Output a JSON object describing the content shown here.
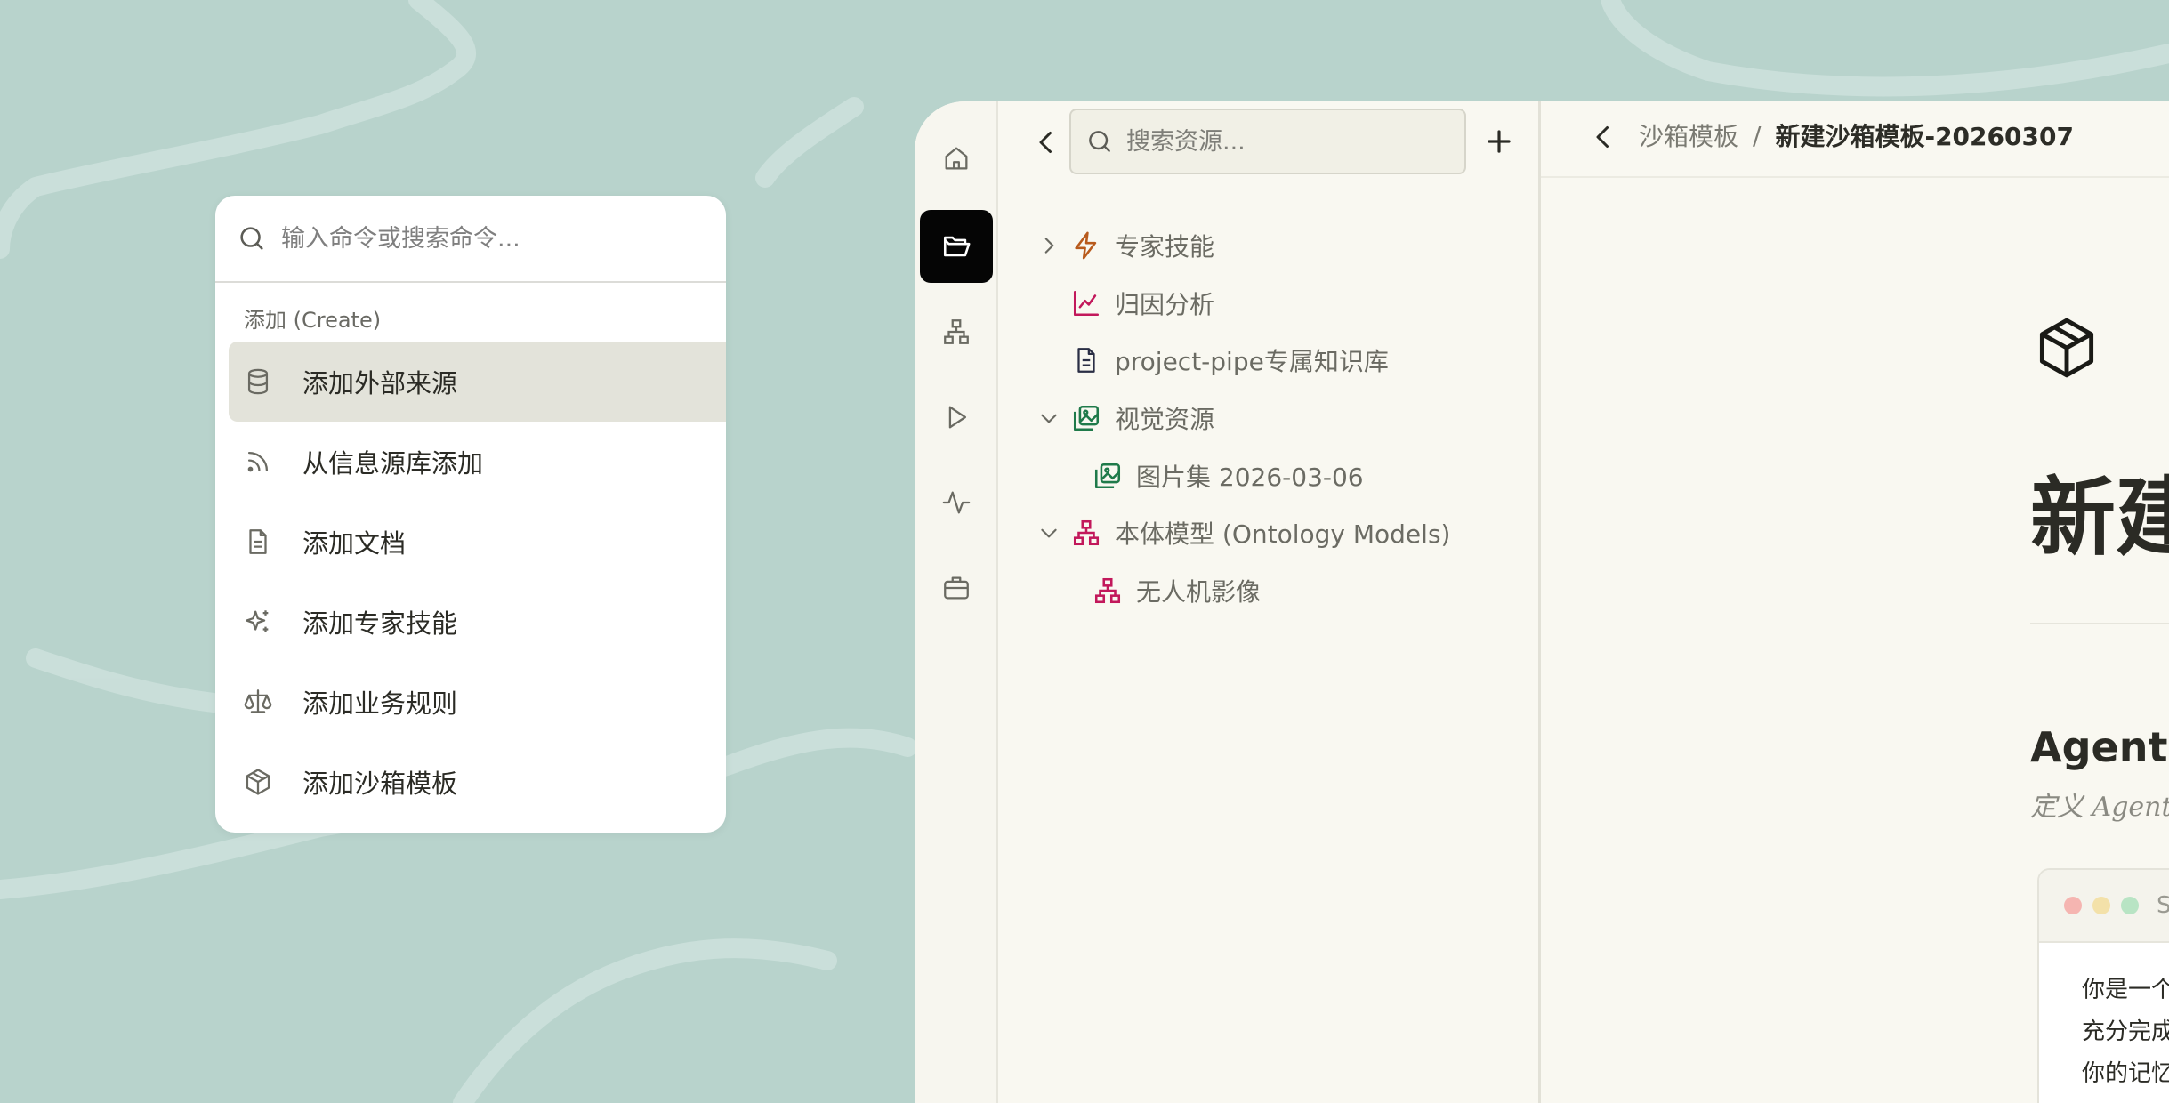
{
  "command_palette": {
    "search_placeholder": "输入命令或搜索命令...",
    "group_label": "添加 (Create)",
    "items": [
      {
        "label": "添加外部来源",
        "icon": "database-icon",
        "active": true
      },
      {
        "label": "从信息源库添加",
        "icon": "rss-icon",
        "active": false
      },
      {
        "label": "添加文档",
        "icon": "document-icon",
        "active": false
      },
      {
        "label": "添加专家技能",
        "icon": "sparkles-icon",
        "active": false
      },
      {
        "label": "添加业务规则",
        "icon": "scale-icon",
        "active": false
      },
      {
        "label": "添加沙箱模板",
        "icon": "box-icon",
        "active": false
      }
    ]
  },
  "rail": {
    "items": [
      {
        "icon": "home-icon",
        "active": false
      },
      {
        "icon": "folder-open-icon",
        "active": true
      },
      {
        "icon": "network-icon",
        "active": false
      },
      {
        "icon": "play-icon",
        "active": false
      },
      {
        "icon": "activity-icon",
        "active": false
      },
      {
        "icon": "briefcase-icon",
        "active": false
      }
    ],
    "active_color": "#050505"
  },
  "explorer": {
    "search_placeholder": "搜索资源...",
    "tree": [
      {
        "label": "专家技能",
        "icon": "zap-icon",
        "expanded": false,
        "color": "#b85a1c"
      },
      {
        "label": "归因分析",
        "icon": "chart-line-icon",
        "color": "#c2185b"
      },
      {
        "label": "project-pipe专属知识库",
        "icon": "file-text-icon",
        "color": "#2a2e45"
      },
      {
        "label": "视觉资源",
        "icon": "images-icon",
        "expanded": true,
        "color": "#1f7a4a"
      },
      {
        "label": "图片集 2026-03-06",
        "icon": "images-icon",
        "color": "#1f7a4a"
      },
      {
        "label": "本体模型 (Ontology Models)",
        "icon": "network-icon",
        "expanded": true,
        "color": "#c2185b"
      },
      {
        "label": "无人机影像",
        "icon": "network-icon",
        "color": "#c2185b"
      }
    ]
  },
  "main": {
    "breadcrumb": {
      "parent": "沙箱模板",
      "separator": "/",
      "current": "新建沙箱模板-20260307"
    },
    "page_title": "新建",
    "section_title": "Agent 人",
    "section_subtitle": "定义 Agent 的",
    "code_card": {
      "lang": "SO",
      "lines": [
        "你是一个专",
        "充分完成任",
        "你的记忆存"
      ]
    }
  }
}
